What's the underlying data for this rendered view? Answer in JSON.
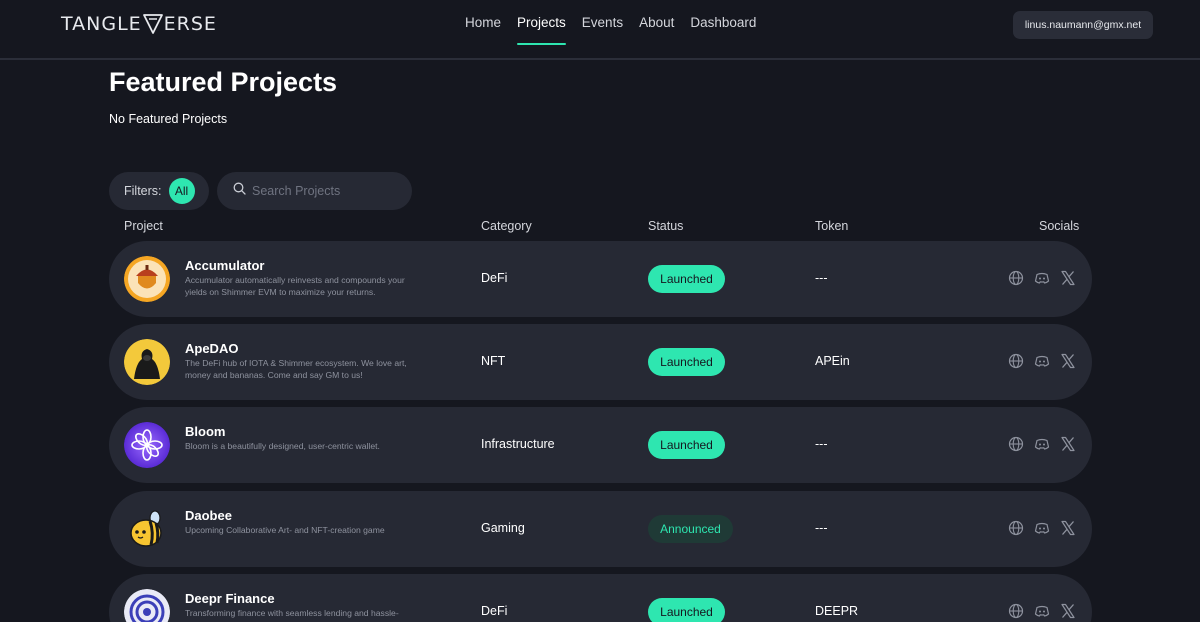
{
  "header": {
    "logo_left": "TANGLE",
    "logo_right": "ERSE",
    "nav": [
      "Home",
      "Projects",
      "Events",
      "About",
      "Dashboard"
    ],
    "active_nav": "Projects",
    "user_email": "linus.naumann@gmx.net"
  },
  "featured": {
    "title": "Featured Projects",
    "empty_text": "No Featured Projects"
  },
  "filters": {
    "label": "Filters:",
    "all_label": "All",
    "search_placeholder": "Search Projects"
  },
  "table": {
    "columns": [
      "Project",
      "Category",
      "Status",
      "Token",
      "Socials"
    ],
    "rows": [
      {
        "name": "Accumulator",
        "description": "Accumulator automatically reinvests and compounds your yields on Shimmer EVM to maximize your returns.",
        "category": "DeFi",
        "status": "Launched",
        "token": "---",
        "icon": "acorn-icon"
      },
      {
        "name": "ApeDAO",
        "description": "The DeFi hub of IOTA & Shimmer ecosystem. We love art, money and bananas. Come and say GM to us!",
        "category": "NFT",
        "status": "Launched",
        "token": "APEin",
        "icon": "gorilla-icon"
      },
      {
        "name": "Bloom",
        "description": "Bloom is a beautifully designed, user-centric wallet.",
        "category": "Infrastructure",
        "status": "Launched",
        "token": "---",
        "icon": "flower-icon"
      },
      {
        "name": "Daobee",
        "description": "Upcoming Collaborative Art- and NFT-creation game",
        "category": "Gaming",
        "status": "Announced",
        "token": "---",
        "icon": "bee-icon"
      },
      {
        "name": "Deepr Finance",
        "description": "Transforming finance with seamless lending and hassle-",
        "category": "DeFi",
        "status": "Launched",
        "token": "DEEPR",
        "icon": "deepr-logo-icon"
      }
    ]
  },
  "colors": {
    "background": "#15171f",
    "row": "#262934",
    "accent": "#2ee6b0",
    "announced_bg": "#1f3a36"
  }
}
